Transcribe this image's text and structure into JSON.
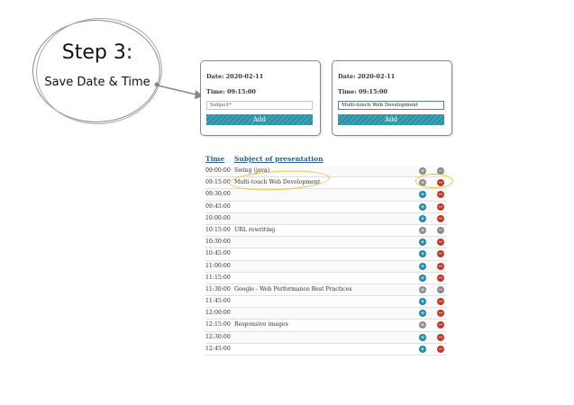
{
  "step": {
    "title": "Step 3:",
    "subtitle": "Save Date & Time"
  },
  "card_left": {
    "date_line": "Date: 2020-02-11",
    "time_line": "Time: 09:15:00",
    "subject_placeholder": "Subject*",
    "add_label": "Add"
  },
  "card_right": {
    "date_line": "Date: 2020-02-11",
    "time_line": "Time: 09:15:00",
    "subject_value": "Multi-touch Web Development",
    "add_label": "Add"
  },
  "table": {
    "headers": {
      "time": "Time",
      "subject": "Subject of presentation"
    },
    "rows": [
      {
        "time": "09:00:00",
        "subject": "Swing (java)",
        "add_grey": true,
        "rem_grey": true
      },
      {
        "time": "09:15:00",
        "subject": "Multi-touch Web Development",
        "add_grey": true,
        "rem_grey": false
      },
      {
        "time": "09:30:00",
        "subject": "",
        "add_grey": false,
        "rem_grey": false
      },
      {
        "time": "09:45:00",
        "subject": "",
        "add_grey": false,
        "rem_grey": false
      },
      {
        "time": "10:00:00",
        "subject": "",
        "add_grey": false,
        "rem_grey": false
      },
      {
        "time": "10:15:00",
        "subject": "URL rewriting",
        "add_grey": true,
        "rem_grey": true
      },
      {
        "time": "10:30:00",
        "subject": "",
        "add_grey": false,
        "rem_grey": false
      },
      {
        "time": "10:45:00",
        "subject": "",
        "add_grey": false,
        "rem_grey": false
      },
      {
        "time": "11:00:00",
        "subject": "",
        "add_grey": false,
        "rem_grey": false
      },
      {
        "time": "11:15:00",
        "subject": "",
        "add_grey": false,
        "rem_grey": false
      },
      {
        "time": "11:30:00",
        "subject": "Google - Web Performance Best Practices",
        "add_grey": true,
        "rem_grey": true
      },
      {
        "time": "11:45:00",
        "subject": "",
        "add_grey": false,
        "rem_grey": false
      },
      {
        "time": "12:00:00",
        "subject": "",
        "add_grey": false,
        "rem_grey": false
      },
      {
        "time": "12:15:00",
        "subject": "Responsive images",
        "add_grey": true,
        "rem_grey": false
      },
      {
        "time": "12:30:00",
        "subject": "",
        "add_grey": false,
        "rem_grey": false
      },
      {
        "time": "12:45:00",
        "subject": "",
        "add_grey": false,
        "rem_grey": false
      }
    ]
  },
  "icons": {
    "add": "plus-icon",
    "remove": "minus-icon",
    "arrow": "arrow-right-icon"
  },
  "colors": {
    "add": "#1b86a8",
    "remove": "#c0392b",
    "disabled": "#8a8a8a",
    "highlight": "#e8c33a",
    "header_link": "#2b5f8a"
  }
}
